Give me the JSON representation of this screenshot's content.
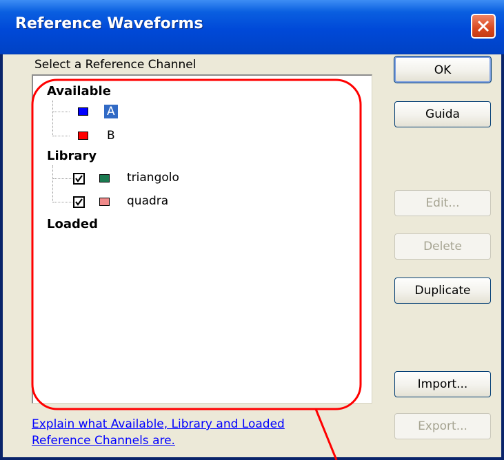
{
  "window": {
    "title": "Reference Waveforms"
  },
  "group_label": "Select a Reference Channel",
  "tree": {
    "available": {
      "label": "Available",
      "items": [
        {
          "label": "A",
          "color": "#0000ff",
          "selected": true
        },
        {
          "label": "B",
          "color": "#ff0000",
          "selected": false
        }
      ]
    },
    "library": {
      "label": "Library",
      "items": [
        {
          "label": "triangolo",
          "color": "#1a7a50",
          "checked": true
        },
        {
          "label": "quadra",
          "color": "#f08a8a",
          "checked": true
        }
      ]
    },
    "loaded": {
      "label": "Loaded"
    }
  },
  "buttons": {
    "ok": "OK",
    "guida": "Guida",
    "edit": "Edit...",
    "delete": "Delete",
    "duplicate": "Duplicate",
    "import": "Import...",
    "export": "Export..."
  },
  "help_link": {
    "line1": "Explain what Available, Library and Loaded",
    "line2": "Reference Channels are."
  },
  "colors": {
    "annotation": "#ff0000",
    "selection": "#316ac5",
    "link": "#0000ff"
  }
}
